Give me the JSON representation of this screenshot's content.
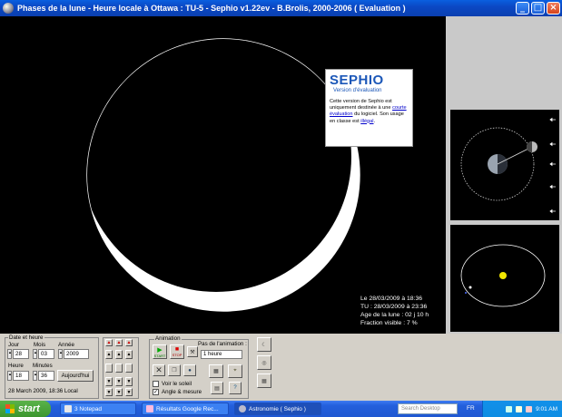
{
  "window": {
    "title": "Phases de la lune - Heure locale à Ottawa : TU-5 - Sephio v1.22ev - B.Brolis, 2000-2006 ( Evaluation )",
    "controls": {
      "minimize": "_",
      "maximize": "□",
      "close": "×"
    }
  },
  "watermark": {
    "brand": "SEPHIO",
    "subtitle": "Version d'évaluation",
    "text_before_link": "Cette version de Sephio est uniquement destinée à une",
    "link1": "courte évaluation",
    "text_mid": "du logiciel. Son usage en classe est",
    "link2": "illégal",
    "text_end": "."
  },
  "info": {
    "line1": "Le 28/03/2009 à 18:36",
    "line2": "TU : 28/03/2009 à 23:36",
    "line3": "Age de la lune : 02 j 10 h",
    "line4": "Fraction visible : 7 %"
  },
  "date_group": {
    "title": "Date et heure",
    "jour_label": "Jour",
    "mois_label": "Mois",
    "annee_label": "Année",
    "jour": "28",
    "mois": "03",
    "annee": "2009",
    "heure_label": "Heure",
    "minutes_label": "Minutes",
    "heure": "18",
    "minutes": "36",
    "today_button": "Aujourd'hui",
    "status": "28 March 2009, 18:36 Local"
  },
  "animation": {
    "title": "Animation",
    "start_label": "START",
    "stop_label": "STOP",
    "step_title": "Pas de l'animation :",
    "step_value": "1 heure",
    "show_sun_label": "Voir le soleil",
    "angle_label": "Angle & mesure",
    "angle_checked": "✓"
  },
  "taskbar": {
    "start": "start",
    "tasks": [
      "3 Notepad",
      "Résultats Google Rec...",
      "Astronomie ( Sephio )"
    ],
    "search_placeholder": "Search Desktop",
    "lang": "FR",
    "clock": "9:01 AM"
  },
  "colors": {
    "title_bar": "#0b48c4",
    "moon_lit": "#ffffff",
    "space": "#000000",
    "sun": "#f2e600",
    "brand": "#1b57b8"
  },
  "moon_phase": {
    "fraction_visible": 0.07
  }
}
